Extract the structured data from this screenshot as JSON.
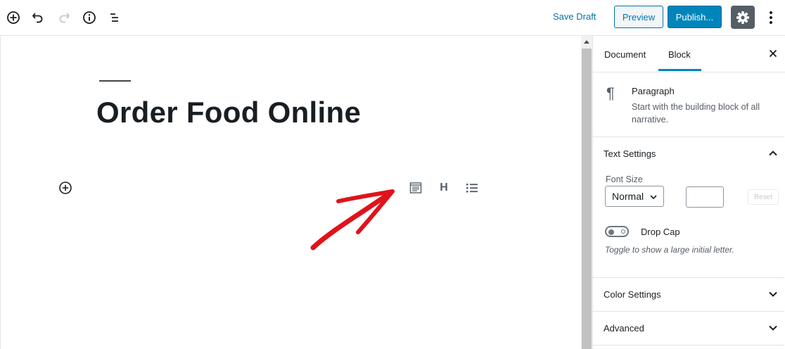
{
  "toolbar": {
    "icons": [
      "add-block-icon",
      "undo-icon",
      "redo-icon",
      "info-icon",
      "block-navigation-icon"
    ],
    "save_draft": "Save Draft",
    "preview": "Preview",
    "publish": "Publish...",
    "settings_icon": "gear-icon",
    "more_icon": "more-vertical-icon"
  },
  "editor": {
    "title": "Order Food Online",
    "inline_tools": [
      "paragraph-icon",
      "heading-icon",
      "list-icon"
    ],
    "heading_glyph": "H",
    "annotation": "red-arrow"
  },
  "sidebar": {
    "tabs": [
      "Document",
      "Block"
    ],
    "active_tab": "Block",
    "block": {
      "icon_glyph": "¶",
      "name": "Paragraph",
      "description": "Start with the building block of all narrative."
    },
    "text_settings": {
      "title": "Text Settings",
      "font_size_label": "Font Size",
      "font_size_value": "Normal",
      "custom_size_value": "",
      "reset_label": "Reset",
      "drop_cap_label": "Drop Cap",
      "drop_cap_enabled": false,
      "drop_cap_help": "Toggle to show a large initial letter."
    },
    "color_settings": {
      "title": "Color Settings"
    },
    "advanced": {
      "title": "Advanced"
    }
  },
  "colors": {
    "accent": "#0085ba",
    "link": "#0073aa",
    "arrow": "#e0131a"
  }
}
